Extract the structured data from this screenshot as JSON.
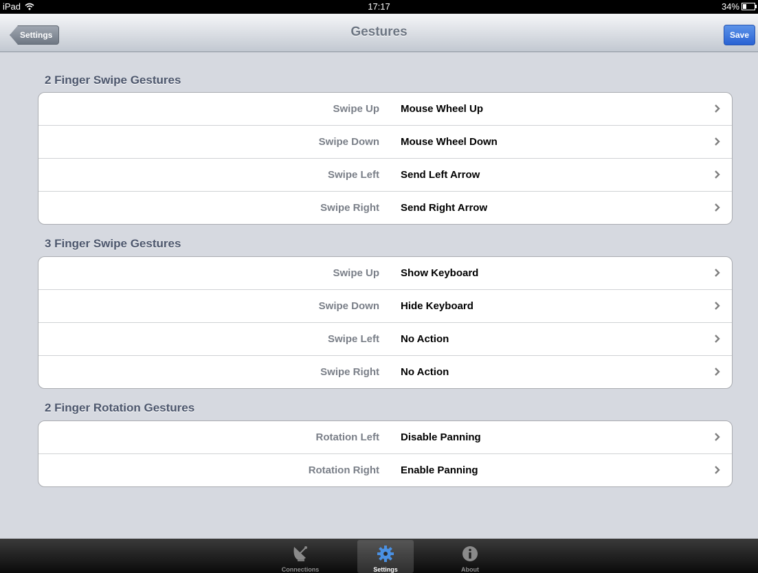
{
  "status_bar": {
    "device": "iPad",
    "time": "17:17",
    "battery_percent": "34%",
    "battery_level": 0.34
  },
  "nav": {
    "back_label": "Settings",
    "title": "Gestures",
    "save_label": "Save"
  },
  "sections": [
    {
      "header": "2 Finger Swipe Gestures",
      "rows": [
        {
          "label": "Swipe Up",
          "value": "Mouse Wheel Up"
        },
        {
          "label": "Swipe Down",
          "value": "Mouse Wheel Down"
        },
        {
          "label": "Swipe Left",
          "value": "Send Left Arrow"
        },
        {
          "label": "Swipe Right",
          "value": "Send Right Arrow"
        }
      ]
    },
    {
      "header": "3 Finger Swipe Gestures",
      "rows": [
        {
          "label": "Swipe Up",
          "value": "Show Keyboard"
        },
        {
          "label": "Swipe Down",
          "value": "Hide Keyboard"
        },
        {
          "label": "Swipe Left",
          "value": "No Action"
        },
        {
          "label": "Swipe Right",
          "value": "No Action"
        }
      ]
    },
    {
      "header": "2 Finger Rotation Gestures",
      "rows": [
        {
          "label": "Rotation Left",
          "value": "Disable Panning"
        },
        {
          "label": "Rotation Right",
          "value": "Enable Panning"
        }
      ]
    }
  ],
  "tabs": [
    {
      "label": "Connections",
      "icon": "satellite-dish-icon",
      "active": false
    },
    {
      "label": "Settings",
      "icon": "gear-icon",
      "active": true
    },
    {
      "label": "About",
      "icon": "info-icon",
      "active": false
    }
  ],
  "colors": {
    "save_button": "#2a63d4",
    "active_tab_icon": "#4a90e2"
  }
}
